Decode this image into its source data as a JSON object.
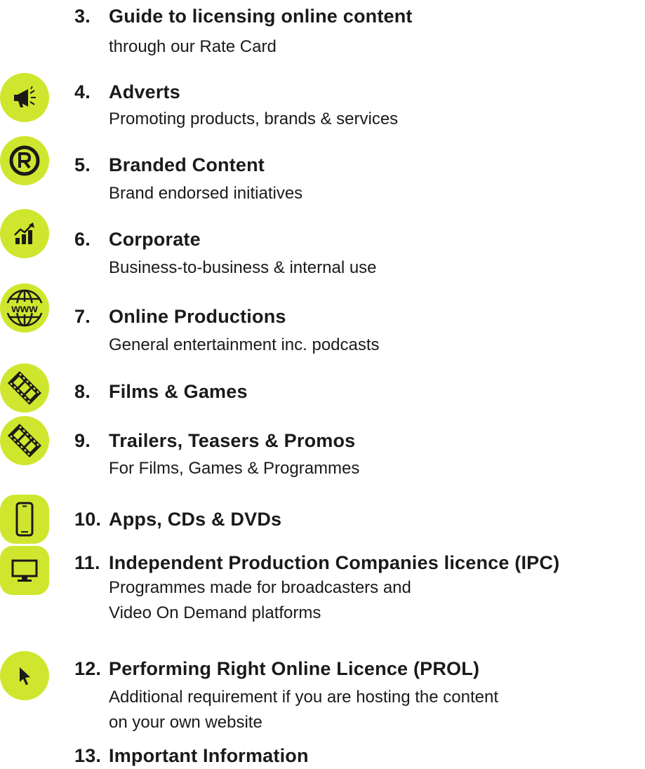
{
  "colors": {
    "accent": "#cfe62e",
    "text": "#1a1a1a"
  },
  "items": [
    {
      "number": "3.",
      "title": "Guide to licensing online content",
      "subtitle": [
        "through our Rate Card"
      ],
      "icon": null
    },
    {
      "number": "4.",
      "title": "Adverts",
      "subtitle": [
        "Promoting products, brands & services"
      ],
      "icon": "megaphone-icon"
    },
    {
      "number": "5.",
      "title": "Branded Content",
      "subtitle": [
        "Brand endorsed initiatives"
      ],
      "icon": "registered-trademark-icon"
    },
    {
      "number": "6.",
      "title": "Corporate",
      "subtitle": [
        "Business-to-business & internal use"
      ],
      "icon": "growth-chart-icon"
    },
    {
      "number": "7.",
      "title": "Online Productions",
      "subtitle": [
        "General entertainment inc. podcasts"
      ],
      "icon": "www-globe-icon"
    },
    {
      "number": "8.",
      "title": "Films & Games",
      "subtitle": [],
      "icon": "film-strip-icon"
    },
    {
      "number": "9.",
      "title": "Trailers, Teasers & Promos",
      "subtitle": [
        "For Films, Games & Programmes"
      ],
      "icon": "film-strip-icon"
    },
    {
      "number": "10.",
      "title": "Apps, CDs & DVDs",
      "subtitle": [],
      "icon": "smartphone-icon"
    },
    {
      "number": "11.",
      "title": "Independent Production Companies licence (IPC)",
      "subtitle": [
        "Programmes made for broadcasters and",
        "Video On Demand platforms"
      ],
      "icon": "monitor-icon"
    },
    {
      "number": "12.",
      "title": "Performing Right Online Licence (PROL)",
      "subtitle": [
        "Additional requirement if you are hosting the content",
        "on your own website"
      ],
      "icon": "cursor-arrow-icon"
    },
    {
      "number": "13.",
      "title": "Important Information",
      "subtitle": [],
      "icon": null
    }
  ]
}
